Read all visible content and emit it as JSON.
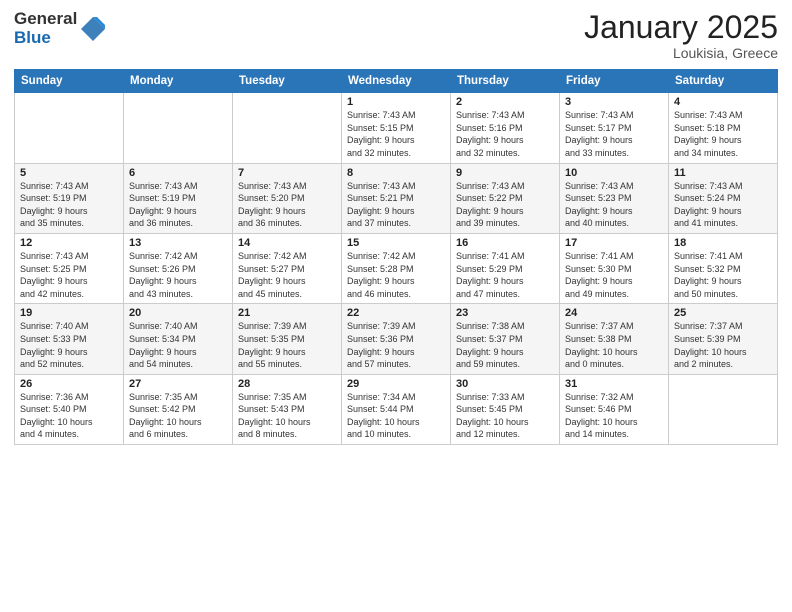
{
  "logo": {
    "general": "General",
    "blue": "Blue"
  },
  "header": {
    "month": "January 2025",
    "location": "Loukisia, Greece"
  },
  "weekdays": [
    "Sunday",
    "Monday",
    "Tuesday",
    "Wednesday",
    "Thursday",
    "Friday",
    "Saturday"
  ],
  "weeks": [
    [
      {
        "day": "",
        "detail": ""
      },
      {
        "day": "",
        "detail": ""
      },
      {
        "day": "",
        "detail": ""
      },
      {
        "day": "1",
        "detail": "Sunrise: 7:43 AM\nSunset: 5:15 PM\nDaylight: 9 hours\nand 32 minutes."
      },
      {
        "day": "2",
        "detail": "Sunrise: 7:43 AM\nSunset: 5:16 PM\nDaylight: 9 hours\nand 32 minutes."
      },
      {
        "day": "3",
        "detail": "Sunrise: 7:43 AM\nSunset: 5:17 PM\nDaylight: 9 hours\nand 33 minutes."
      },
      {
        "day": "4",
        "detail": "Sunrise: 7:43 AM\nSunset: 5:18 PM\nDaylight: 9 hours\nand 34 minutes."
      }
    ],
    [
      {
        "day": "5",
        "detail": "Sunrise: 7:43 AM\nSunset: 5:19 PM\nDaylight: 9 hours\nand 35 minutes."
      },
      {
        "day": "6",
        "detail": "Sunrise: 7:43 AM\nSunset: 5:19 PM\nDaylight: 9 hours\nand 36 minutes."
      },
      {
        "day": "7",
        "detail": "Sunrise: 7:43 AM\nSunset: 5:20 PM\nDaylight: 9 hours\nand 36 minutes."
      },
      {
        "day": "8",
        "detail": "Sunrise: 7:43 AM\nSunset: 5:21 PM\nDaylight: 9 hours\nand 37 minutes."
      },
      {
        "day": "9",
        "detail": "Sunrise: 7:43 AM\nSunset: 5:22 PM\nDaylight: 9 hours\nand 39 minutes."
      },
      {
        "day": "10",
        "detail": "Sunrise: 7:43 AM\nSunset: 5:23 PM\nDaylight: 9 hours\nand 40 minutes."
      },
      {
        "day": "11",
        "detail": "Sunrise: 7:43 AM\nSunset: 5:24 PM\nDaylight: 9 hours\nand 41 minutes."
      }
    ],
    [
      {
        "day": "12",
        "detail": "Sunrise: 7:43 AM\nSunset: 5:25 PM\nDaylight: 9 hours\nand 42 minutes."
      },
      {
        "day": "13",
        "detail": "Sunrise: 7:42 AM\nSunset: 5:26 PM\nDaylight: 9 hours\nand 43 minutes."
      },
      {
        "day": "14",
        "detail": "Sunrise: 7:42 AM\nSunset: 5:27 PM\nDaylight: 9 hours\nand 45 minutes."
      },
      {
        "day": "15",
        "detail": "Sunrise: 7:42 AM\nSunset: 5:28 PM\nDaylight: 9 hours\nand 46 minutes."
      },
      {
        "day": "16",
        "detail": "Sunrise: 7:41 AM\nSunset: 5:29 PM\nDaylight: 9 hours\nand 47 minutes."
      },
      {
        "day": "17",
        "detail": "Sunrise: 7:41 AM\nSunset: 5:30 PM\nDaylight: 9 hours\nand 49 minutes."
      },
      {
        "day": "18",
        "detail": "Sunrise: 7:41 AM\nSunset: 5:32 PM\nDaylight: 9 hours\nand 50 minutes."
      }
    ],
    [
      {
        "day": "19",
        "detail": "Sunrise: 7:40 AM\nSunset: 5:33 PM\nDaylight: 9 hours\nand 52 minutes."
      },
      {
        "day": "20",
        "detail": "Sunrise: 7:40 AM\nSunset: 5:34 PM\nDaylight: 9 hours\nand 54 minutes."
      },
      {
        "day": "21",
        "detail": "Sunrise: 7:39 AM\nSunset: 5:35 PM\nDaylight: 9 hours\nand 55 minutes."
      },
      {
        "day": "22",
        "detail": "Sunrise: 7:39 AM\nSunset: 5:36 PM\nDaylight: 9 hours\nand 57 minutes."
      },
      {
        "day": "23",
        "detail": "Sunrise: 7:38 AM\nSunset: 5:37 PM\nDaylight: 9 hours\nand 59 minutes."
      },
      {
        "day": "24",
        "detail": "Sunrise: 7:37 AM\nSunset: 5:38 PM\nDaylight: 10 hours\nand 0 minutes."
      },
      {
        "day": "25",
        "detail": "Sunrise: 7:37 AM\nSunset: 5:39 PM\nDaylight: 10 hours\nand 2 minutes."
      }
    ],
    [
      {
        "day": "26",
        "detail": "Sunrise: 7:36 AM\nSunset: 5:40 PM\nDaylight: 10 hours\nand 4 minutes."
      },
      {
        "day": "27",
        "detail": "Sunrise: 7:35 AM\nSunset: 5:42 PM\nDaylight: 10 hours\nand 6 minutes."
      },
      {
        "day": "28",
        "detail": "Sunrise: 7:35 AM\nSunset: 5:43 PM\nDaylight: 10 hours\nand 8 minutes."
      },
      {
        "day": "29",
        "detail": "Sunrise: 7:34 AM\nSunset: 5:44 PM\nDaylight: 10 hours\nand 10 minutes."
      },
      {
        "day": "30",
        "detail": "Sunrise: 7:33 AM\nSunset: 5:45 PM\nDaylight: 10 hours\nand 12 minutes."
      },
      {
        "day": "31",
        "detail": "Sunrise: 7:32 AM\nSunset: 5:46 PM\nDaylight: 10 hours\nand 14 minutes."
      },
      {
        "day": "",
        "detail": ""
      }
    ]
  ]
}
